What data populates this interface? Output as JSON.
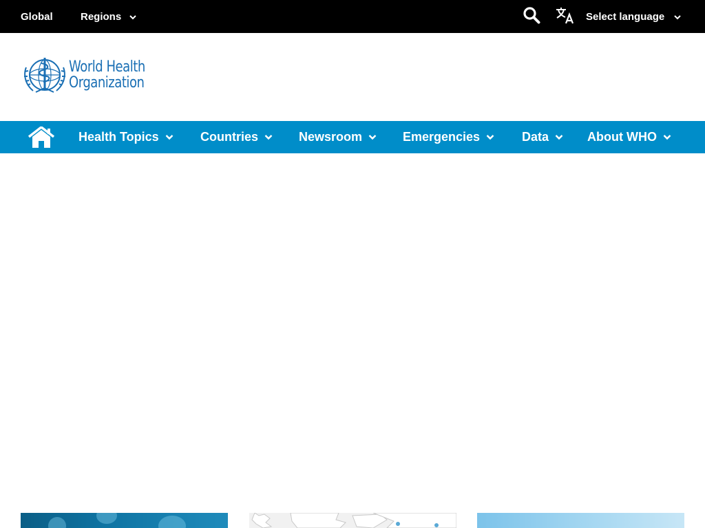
{
  "topbar": {
    "global_label": "Global",
    "regions_label": "Regions",
    "language_label": "Select language",
    "icons": {
      "search": "search-icon",
      "language": "translate-icon",
      "chevron": "chevron-down-icon"
    }
  },
  "logo": {
    "line1": "World Health",
    "line2": "Organization",
    "emblem": "who-emblem"
  },
  "mainnav": {
    "home_icon": "home-icon",
    "items": [
      {
        "label": "Health Topics"
      },
      {
        "label": "Countries"
      },
      {
        "label": "Newsroom"
      },
      {
        "label": "Emergencies"
      },
      {
        "label": "Data"
      },
      {
        "label": "About WHO"
      }
    ]
  },
  "cards": [
    {
      "image": "coronavirus-image"
    },
    {
      "image": "world-map-image"
    },
    {
      "image": "sky-image"
    }
  ],
  "colors": {
    "topbar_bg": "#000000",
    "nav_bg": "#008dc9",
    "brand_blue": "#1a6fb4",
    "page_bg": "#ffffff"
  }
}
